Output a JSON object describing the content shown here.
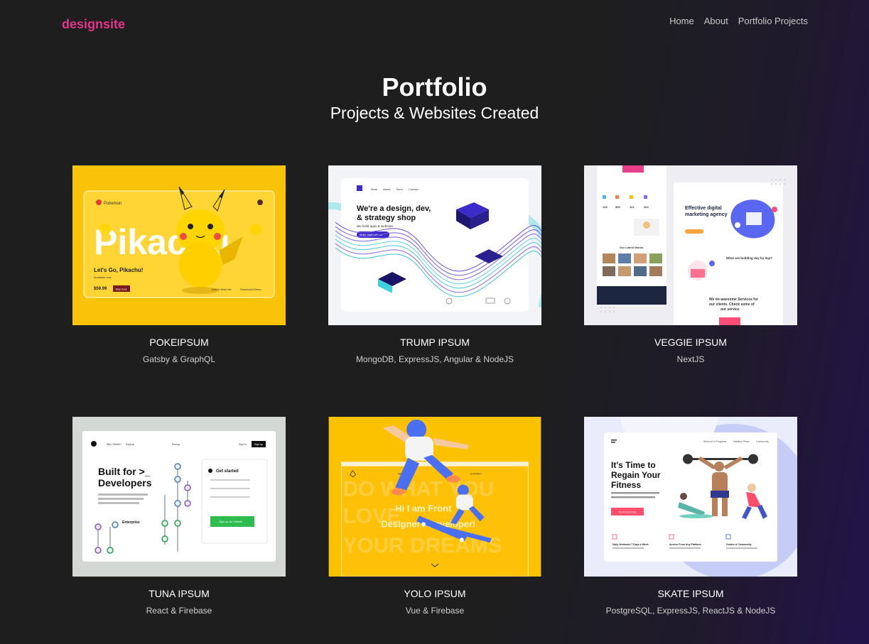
{
  "brand": "designsite",
  "nav": [
    {
      "label": "Home"
    },
    {
      "label": "About"
    },
    {
      "label": "Portfolio Projects"
    }
  ],
  "hero": {
    "title": "Portfolio",
    "subtitle": "Projects & Websites Created"
  },
  "projects": [
    {
      "title": "POKEIPSUM",
      "stack": "Gatsby & GraphQL",
      "thumb": {
        "bg": "#f9c90d",
        "text": [
          "Pokemon",
          "Pikachu",
          "Let's Go, Pikachu!",
          "Available now",
          "$59.99",
          "Buy now",
          "Add to Wish list",
          "Download Demo"
        ]
      }
    },
    {
      "title": "TRUMP IPSUM",
      "stack": "MongoDB, ExpressJS, Angular & NodeJS",
      "thumb": {
        "bg": "#f3f4f8",
        "text": [
          "We're a design, dev,",
          "& strategy shop",
          "We build apps & websites",
          "Work",
          "About",
          "Team",
          "Contact",
          "Make stuff with us"
        ]
      }
    },
    {
      "title": "VEGGIE IPSUM",
      "stack": "NextJS",
      "thumb": {
        "bg": "#eeeef2",
        "text": [
          "Effective digital",
          "marketing agency",
          "What are building day by day?",
          "We do awesome Services for",
          "our clients. Check some of",
          "our service",
          "Our Latest Works",
          "125",
          "500",
          "101",
          "204"
        ]
      }
    },
    {
      "title": "TUNA IPSUM",
      "stack": "React & Firebase",
      "thumb": {
        "bg": "#d4d8d5",
        "text": [
          "Built for >_",
          "Developers",
          "Get started",
          "Enterprise",
          "Sign up for GitHub",
          "Why GitHub?",
          "Explore",
          "Pricing",
          "Sign in",
          "Sign up"
        ]
      }
    },
    {
      "title": "YOLO IPSUM",
      "stack": "Vue & Firebase",
      "thumb": {
        "bg": "#fcc200",
        "text": [
          "Hi I am Front",
          "Designer / Developer!",
          "DO WHAT YOU",
          "LOVE",
          "YOUR DREAMS",
          "ABOUT",
          "CONTACT"
        ]
      }
    },
    {
      "title": "SKATE IPSUM",
      "stack": "PostgreSQL, ExpressJS, ReactJS & NodeJS",
      "thumb": {
        "bg": "#e9ecfa",
        "text": [
          "It's Time to",
          "Regain Your",
          "Fitness",
          "Try It For Free",
          "Daily Workouts 7 Days a Week",
          "Access From Any Platform",
          "Guides & Community",
          "Workout & Programs",
          "Nutrition Plans",
          "Community"
        ]
      }
    }
  ]
}
